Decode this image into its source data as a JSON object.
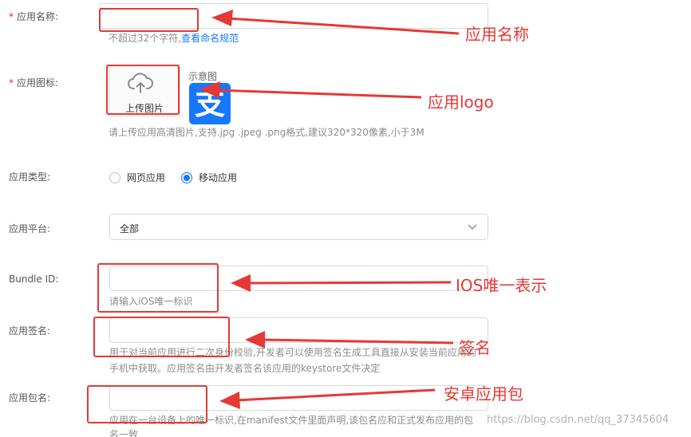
{
  "form": {
    "app_name": {
      "label": "应用名称:",
      "required_mark": "*",
      "hint": "不超过32个字符,",
      "hint_link": "查看命名规范"
    },
    "app_icon": {
      "label": "应用图标:",
      "required_mark": "*",
      "upload_label": "上传图片",
      "preview_label": "示意图",
      "preview_glyph": "支",
      "hint": "请上传应用高清图片,支持.jpg .jpeg .png格式,建议320*320像素,小于3M"
    },
    "app_type": {
      "label": "应用类型:",
      "options": [
        "网页应用",
        "移动应用"
      ],
      "selected": "移动应用"
    },
    "app_platform": {
      "label": "应用平台:",
      "value": "全部"
    },
    "bundle_id": {
      "label": "Bundle ID:",
      "hint": "请输入iOS唯一标识"
    },
    "app_signature": {
      "label": "应用签名:",
      "hint_line1": "用于对当前应用进行二次身份校验,开发者可以使用签名生成工具直接从安装当前应用的",
      "hint_line2": "手机中获取。应用签名由开发者签名该应用的keystore文件决定"
    },
    "package_name": {
      "label": "应用包名:",
      "hint_line1": "应用在一台设备上的唯一标识,在manifest文件里面声明,该包名应和正式发布应用的包",
      "hint_line2": "名一致"
    }
  },
  "annotations": {
    "app_name": "应用名称",
    "app_logo": "应用logo",
    "ios_id": "IOS唯一表示",
    "signature": "签名",
    "android_package": "安卓应用包"
  },
  "watermark": "https://blog.csdn.net/qq_37345604",
  "colors": {
    "accent": "#1677ff",
    "annotation_red": "#e53935",
    "alipay_blue": "#1677ff",
    "required_red": "#f5222d"
  },
  "icons": {
    "upload": "cloud-upload-icon",
    "select_arrow": "chevron-down-icon",
    "preview": "alipay-logo-icon"
  }
}
